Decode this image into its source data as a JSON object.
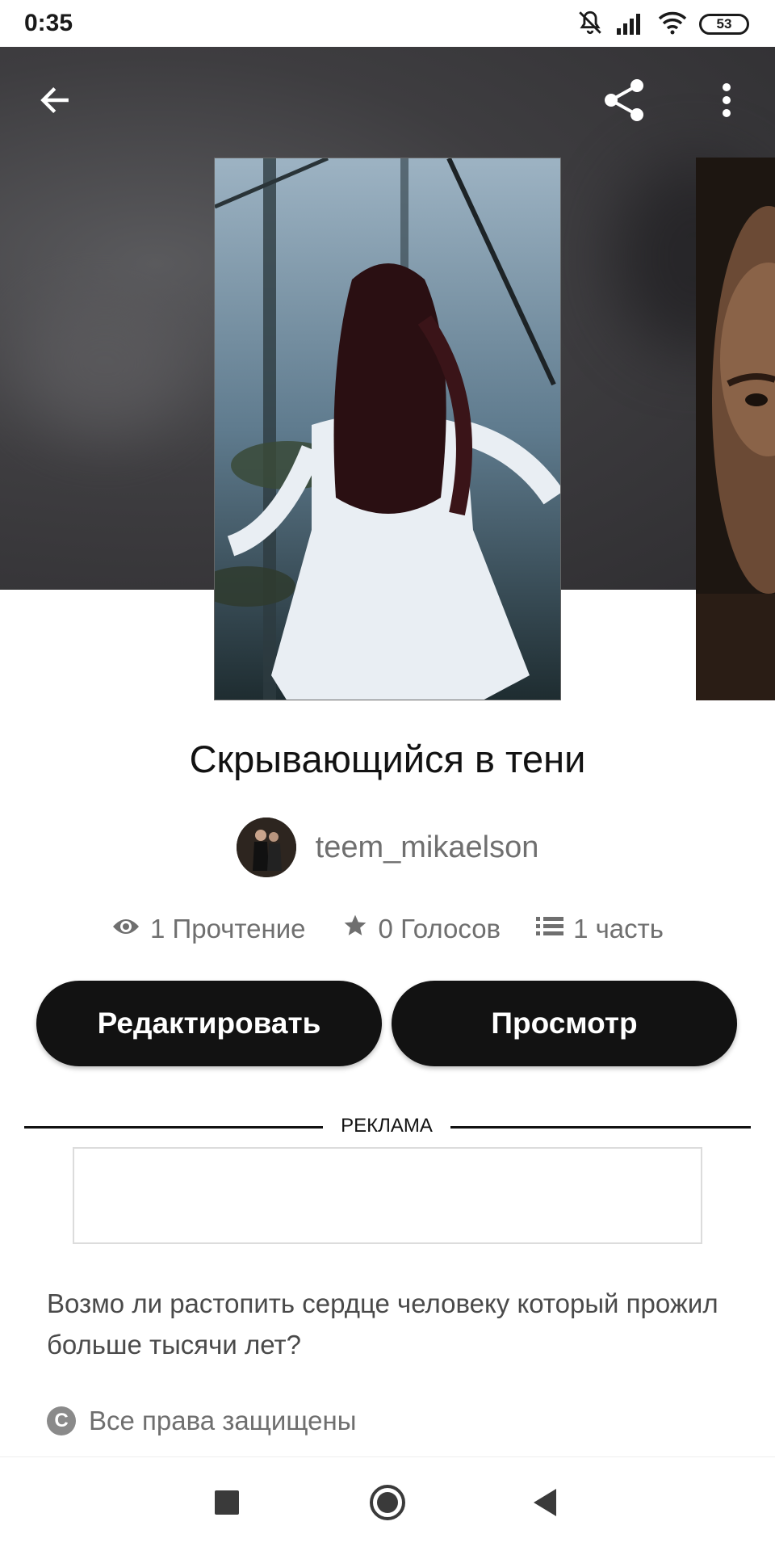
{
  "status_bar": {
    "time": "0:35",
    "icons": [
      "mute-bell-icon",
      "signal-icon",
      "wifi-icon"
    ],
    "battery": "53"
  },
  "header": {
    "back_icon": "arrow-left-icon",
    "share_icon": "share-icon",
    "more_icon": "more-vertical-icon"
  },
  "story": {
    "title": "Скрывающийся в тени",
    "author": "teem_mikaelson",
    "stats": {
      "reads": "1 Прочтение",
      "votes": "0 Голосов",
      "parts": "1 часть"
    },
    "description": "Возмо ли растопить сердце человеку который прожил больше тысячи лет?",
    "copyright": "Все права защищены"
  },
  "actions": {
    "edit_label": "Редактировать",
    "view_label": "Просмотр"
  },
  "ad": {
    "label": "РЕКЛАМА"
  },
  "colors": {
    "button_bg": "#121212",
    "header_bg": "#3e3d40",
    "muted_text": "#6f6f6f"
  },
  "nav": {
    "icons": [
      "recents-square-icon",
      "home-circle-icon",
      "back-triangle-icon"
    ]
  }
}
